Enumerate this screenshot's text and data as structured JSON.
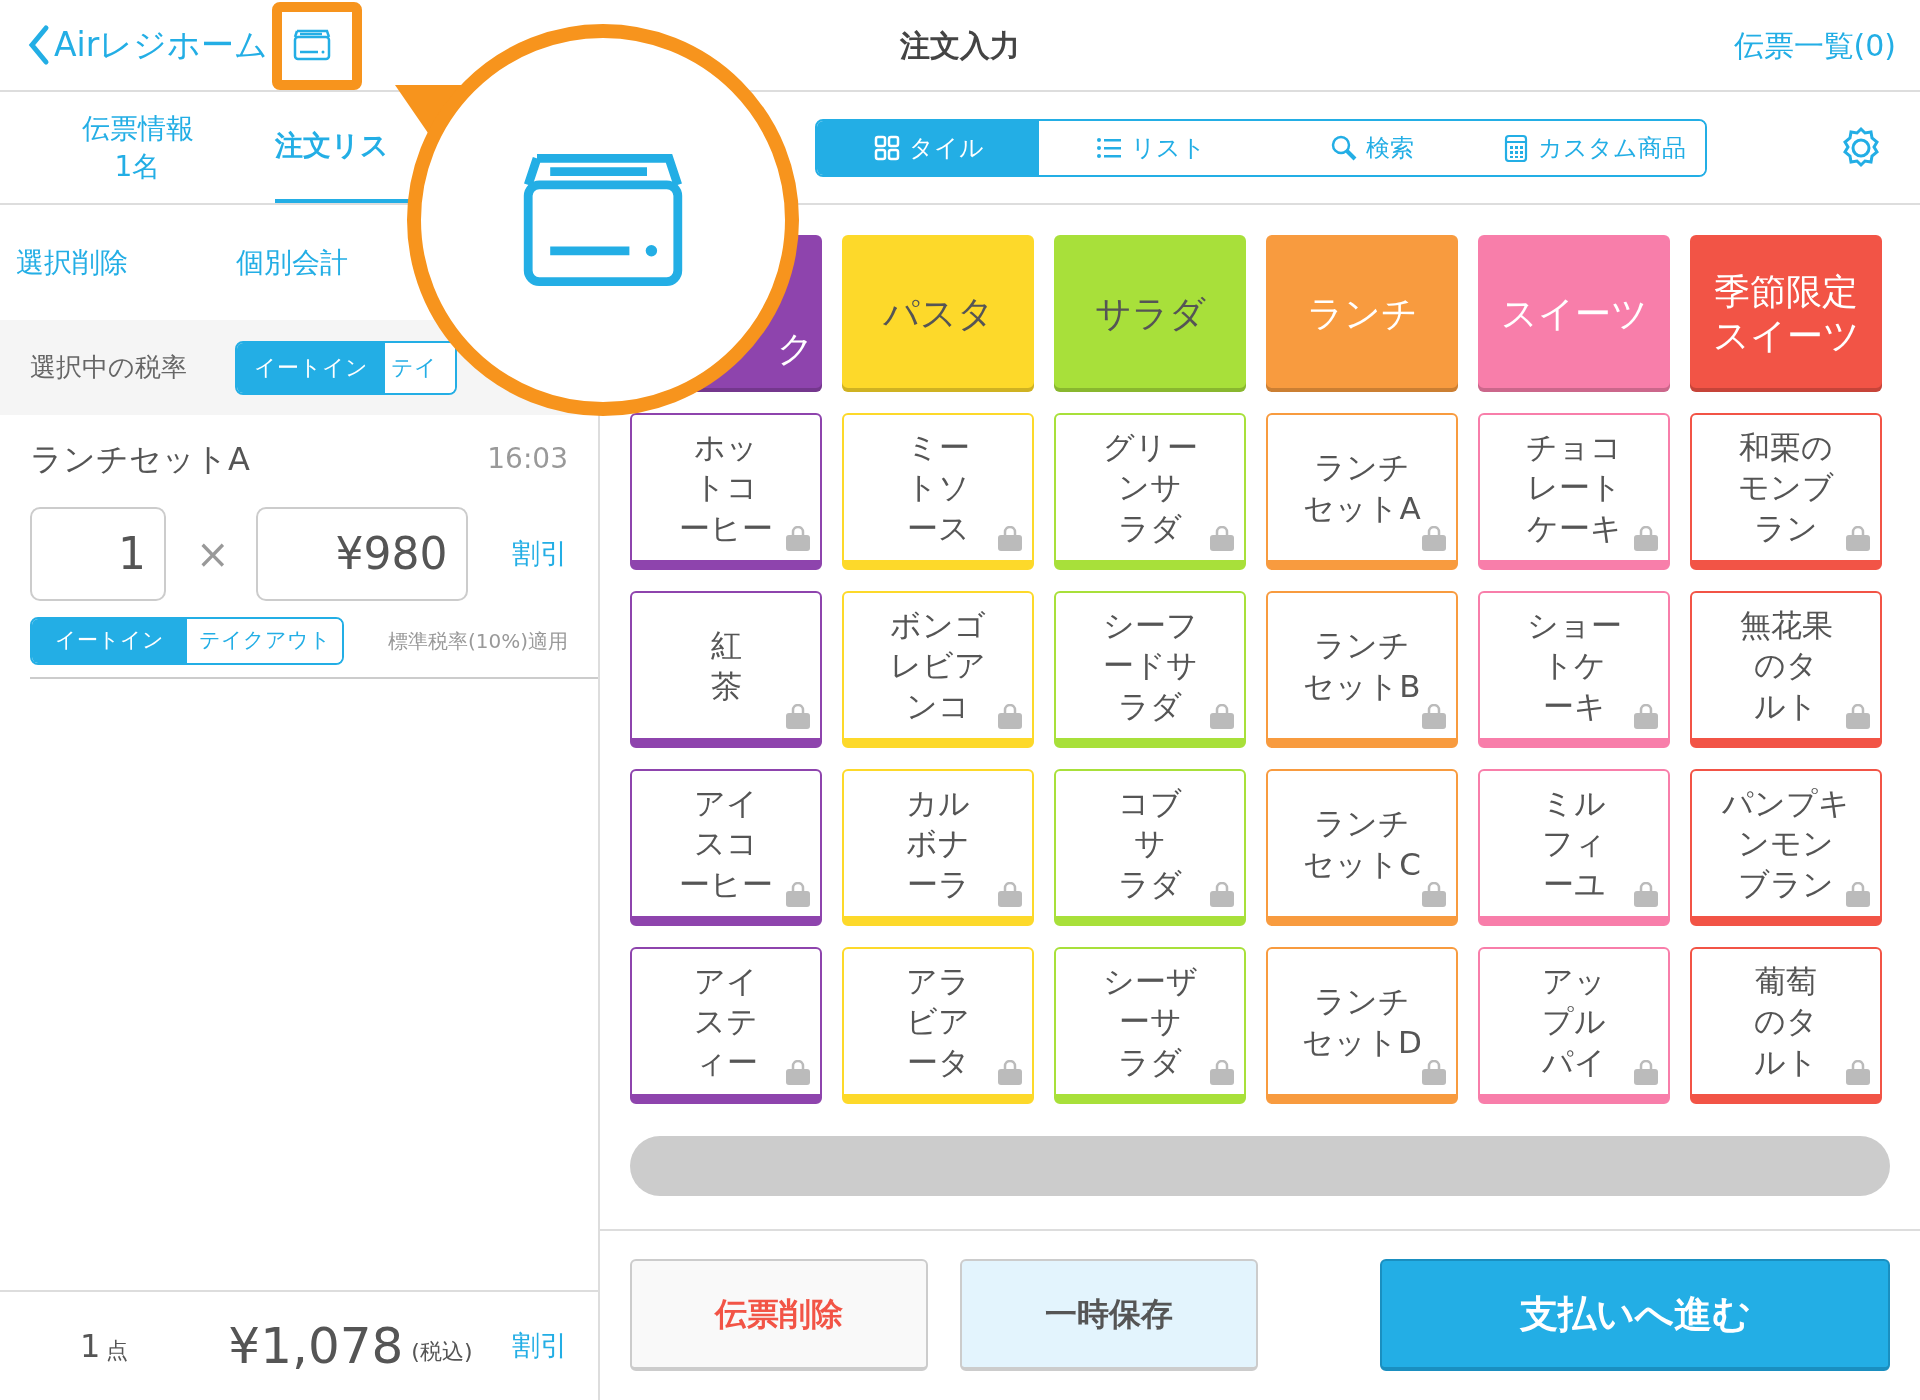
{
  "header": {
    "back_label": "Airレジホーム",
    "title": "注文入力",
    "slip_list": "伝票一覧(0)"
  },
  "left_tabs": [
    {
      "label": "伝票情報",
      "sub": "1名",
      "selected": false
    },
    {
      "label": "注文リス",
      "selected": true
    }
  ],
  "actions": [
    "選択削除",
    "個別会計"
  ],
  "tax_rate": {
    "label": "選択中の税率",
    "options": [
      {
        "label": "イートイン",
        "selected": true
      },
      {
        "label": "テイ",
        "selected": false
      }
    ]
  },
  "order_items": [
    {
      "name": "ランチセットA",
      "time": "16:03",
      "quantity": "1",
      "times": "×",
      "price": "¥980",
      "discount": "割引",
      "options": [
        {
          "label": "イートイン",
          "selected": true
        },
        {
          "label": "テイクアウト",
          "selected": false
        }
      ],
      "note": "標準税率(10%)適用"
    }
  ],
  "footer": {
    "count": "1",
    "count_unit": "点",
    "total": "¥1,078",
    "tax_note": "(税込)",
    "discount": "割引"
  },
  "view_tabs": [
    {
      "label": "タイル",
      "kind": "tile",
      "selected": true
    },
    {
      "label": "リスト",
      "kind": "list",
      "selected": false
    },
    {
      "label": "検索",
      "kind": "search",
      "selected": false
    },
    {
      "label": "カスタム商品",
      "kind": "calculator",
      "selected": false
    }
  ],
  "categories": [
    {
      "label": "ク",
      "color": "#8e44ad",
      "items": [
        "ホットコーヒー",
        "紅茶",
        "アイスコーヒー",
        "アイスティー"
      ]
    },
    {
      "label": "パスタ",
      "color": "#fdd92a",
      "items": [
        "ミートソース",
        "ボンゴレビアンコ",
        "カルボナーラ",
        "アラビアータ"
      ]
    },
    {
      "label": "サラダ",
      "color": "#a8e03a",
      "items": [
        "グリーンサラダ",
        "シーフードサラダ",
        "コブサラダ",
        "シーザーサラダ"
      ]
    },
    {
      "label": "ランチ",
      "color": "#f89b3f",
      "items": [
        "ランチセットA",
        "ランチセットB",
        "ランチセットC",
        "ランチセットD"
      ]
    },
    {
      "label": "スイーツ",
      "color": "#f87eaa",
      "items": [
        "チョコレートケーキ",
        "ショートケーキ",
        "ミルフィーユ",
        "アップルパイ"
      ]
    },
    {
      "label": "季節限定スイーツ",
      "color": "#f25446",
      "items": [
        "和栗のモンブラン",
        "無花果のタルト",
        "パンプキンモンブラン",
        "葡萄のタルト"
      ]
    }
  ],
  "bottom_buttons": [
    {
      "label": "伝票削除",
      "kind": "delete"
    },
    {
      "label": "一時保存",
      "kind": "hold"
    },
    {
      "label": "支払いへ進む",
      "kind": "pay"
    }
  ]
}
